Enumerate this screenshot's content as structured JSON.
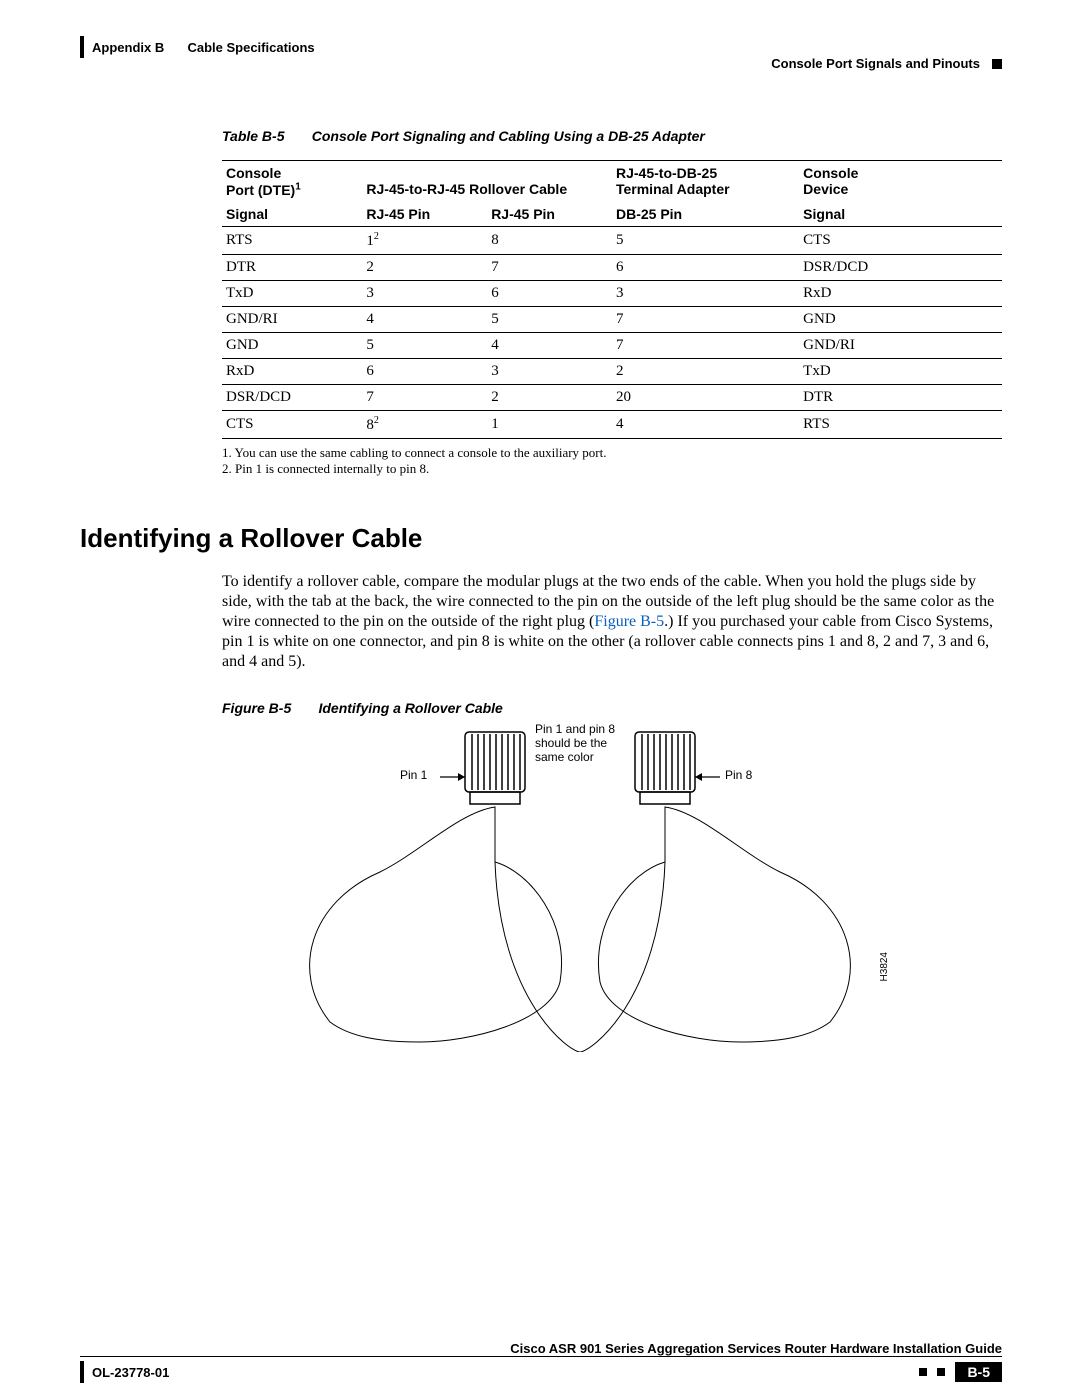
{
  "header": {
    "appendix": "Appendix B",
    "title": "Cable Specifications",
    "right_title": "Console Port Signals and Pinouts"
  },
  "table": {
    "label": "Table B-5",
    "title": "Console Port Signaling and Cabling Using a DB-25 Adapter",
    "head1": {
      "c1a": "Console",
      "c1b": "Port (DTE)",
      "c2": "RJ-45-to-RJ-45 Rollover Cable",
      "c3a": "RJ-45-to-DB-25",
      "c3b": "Terminal Adapter",
      "c4a": "Console",
      "c4b": "Device"
    },
    "head2": {
      "c1": "Signal",
      "c2": "RJ-45 Pin",
      "c3": "RJ-45 Pin",
      "c4": "DB-25 Pin",
      "c5": "Signal"
    },
    "rows": [
      [
        "RTS",
        "1",
        "2",
        "8",
        "5",
        "CTS"
      ],
      [
        "DTR",
        "2",
        "",
        "7",
        "6",
        "DSR/DCD"
      ],
      [
        "TxD",
        "3",
        "",
        "6",
        "3",
        "RxD"
      ],
      [
        "GND/RI",
        "4",
        "",
        "5",
        "7",
        "GND"
      ],
      [
        "GND",
        "5",
        "",
        "4",
        "7",
        "GND/RI"
      ],
      [
        "RxD",
        "6",
        "",
        "3",
        "2",
        "TxD"
      ],
      [
        "DSR/DCD",
        "7",
        "",
        "2",
        "20",
        "DTR"
      ],
      [
        "CTS",
        "8",
        "2",
        "1",
        "4",
        "RTS"
      ]
    ],
    "footnotes": [
      "1. You can use the same cabling to connect a console to the auxiliary port.",
      "2. Pin 1 is connected internally to pin 8."
    ]
  },
  "section": {
    "heading": "Identifying a Rollover Cable",
    "para_a": "To identify a rollover cable, compare the modular plugs at the two ends of the cable. When you hold the plugs side by side, with the tab at the back, the wire connected to the pin on the outside of the left plug should be the same color as the wire connected to the pin on the outside of the right plug (",
    "link": "Figure B-5",
    "para_b": ".) If you purchased your cable from Cisco Systems, pin 1 is white on one connector, and pin 8 is white on the other (a rollover cable connects pins 1 and 8, 2 and 7, 3 and 6, and 4 and 5)."
  },
  "figure": {
    "label": "Figure B-5",
    "title": "Identifying a Rollover Cable",
    "pin1": "Pin 1",
    "pin8": "Pin 8",
    "note1": "Pin 1 and pin 8",
    "note2": "should be the",
    "note3": "same color",
    "id": "H3824"
  },
  "footer": {
    "guide": "Cisco ASR 901 Series Aggregation Services Router Hardware Installation Guide",
    "doc": "OL-23778-01",
    "page": "B-5"
  }
}
